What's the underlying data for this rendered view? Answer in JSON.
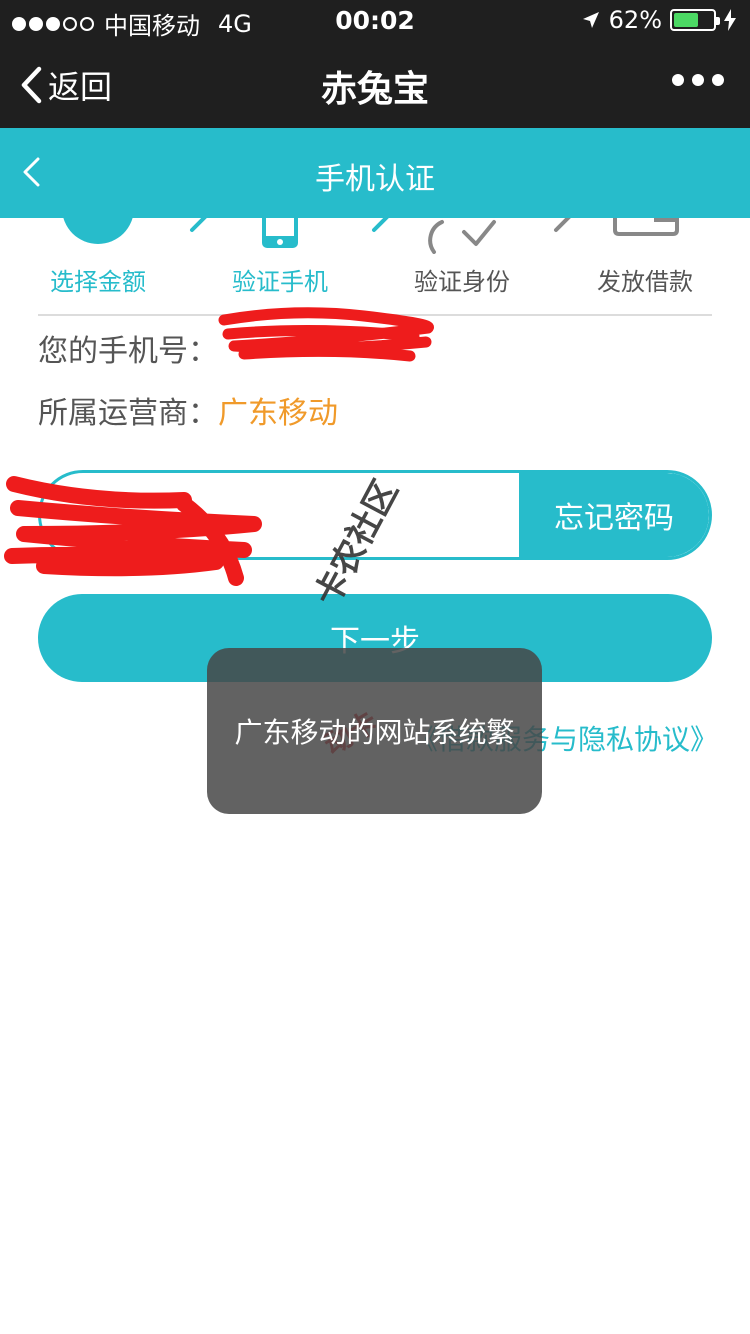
{
  "status_bar": {
    "carrier": "中国移动",
    "network": "4G",
    "time": "00:02",
    "battery": "62%",
    "battery_level": 0.62
  },
  "nav": {
    "back_label": "返回",
    "title": "赤兔宝"
  },
  "sub_header": {
    "title": "手机认证"
  },
  "steps": [
    {
      "label": "选择金额",
      "state": "active"
    },
    {
      "label": "验证手机",
      "state": "active"
    },
    {
      "label": "验证身份",
      "state": "inactive"
    },
    {
      "label": "发放借款",
      "state": "inactive"
    }
  ],
  "phone_info": {
    "phone_label": "您的手机号：",
    "carrier_label": "所属运营商：",
    "carrier_value": "广东移动"
  },
  "password": {
    "forgot_label": "忘记密码"
  },
  "next_label": "下一步",
  "agreement": "《借款服务与隐私协议》",
  "toast": "广东移动的网站系统繁",
  "watermark": {
    "text": "卡农社区",
    "red_text": "动卡"
  },
  "colors": {
    "accent": "#27bccb",
    "carrier_value": "#f09a2a",
    "header_dark": "#1f1f1f",
    "redaction": "#ee1c1c"
  }
}
